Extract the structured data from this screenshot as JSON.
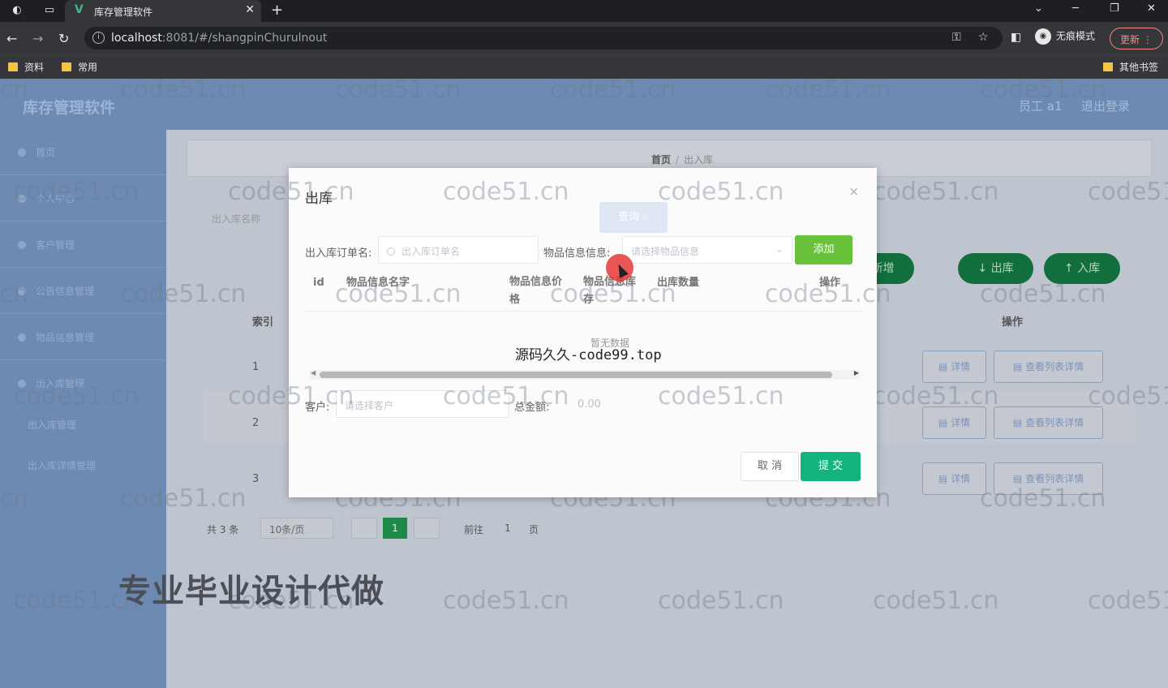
{
  "browser": {
    "tab_title": "库存管理软件",
    "tab_close": "✕",
    "new_tab": "+",
    "url_host": "localhost",
    "url_rest": ":8081/#/shangpinChurulnout",
    "incognito_label": "无痕模式",
    "update_label": "更新",
    "bookmarks": [
      "资料",
      "常用"
    ],
    "other_bookmarks": "其他书签"
  },
  "app": {
    "title": "库存管理软件",
    "header_user": "员工 a1",
    "logout": "退出登录",
    "sidebar": {
      "items": [
        "首页",
        "个人中心",
        "客户管理",
        "公告信息管理",
        "物品信息管理",
        "出入库管理"
      ],
      "sub_items": [
        "出入库管理",
        "出入库详情管理"
      ]
    },
    "breadcrumb": {
      "home": "首页",
      "current": "出入库"
    },
    "search_label": "出入库名称",
    "buttons": {
      "add": "新增",
      "out": "出库",
      "in": "入库"
    },
    "table": {
      "headers": {
        "index": "索引",
        "ops": "操作"
      },
      "rows": [
        "1",
        "2",
        "3"
      ],
      "detail": "详情",
      "list_detail": "查看列表详情"
    },
    "pager": {
      "total": "共 3 条",
      "size": "10条/页",
      "page": "1",
      "goto": "前往",
      "goto_val": "1",
      "page_suffix": "页"
    }
  },
  "dialog": {
    "title": "出库",
    "close": "×",
    "search_btn": "查询",
    "order_label": "出入库订单名:",
    "order_placeholder": "出入库订单名",
    "goods_label": "物品信息信息:",
    "goods_placeholder": "请选择物品信息",
    "add_btn": "添加",
    "columns": [
      "id",
      "物品信息名字",
      "物品信息价格",
      "物品信息库存",
      "出库数量",
      "操作"
    ],
    "empty": "暂无数据",
    "customer_label": "客户:",
    "customer_placeholder": "请选择客户",
    "total_label": "总金额:",
    "total_value": "0.00",
    "cancel": "取 消",
    "submit": "提 交"
  },
  "overlay": {
    "code_text": "源码久久-code99.top",
    "ad_text": "专业毕业设计代做",
    "watermark": "code51.cn"
  }
}
